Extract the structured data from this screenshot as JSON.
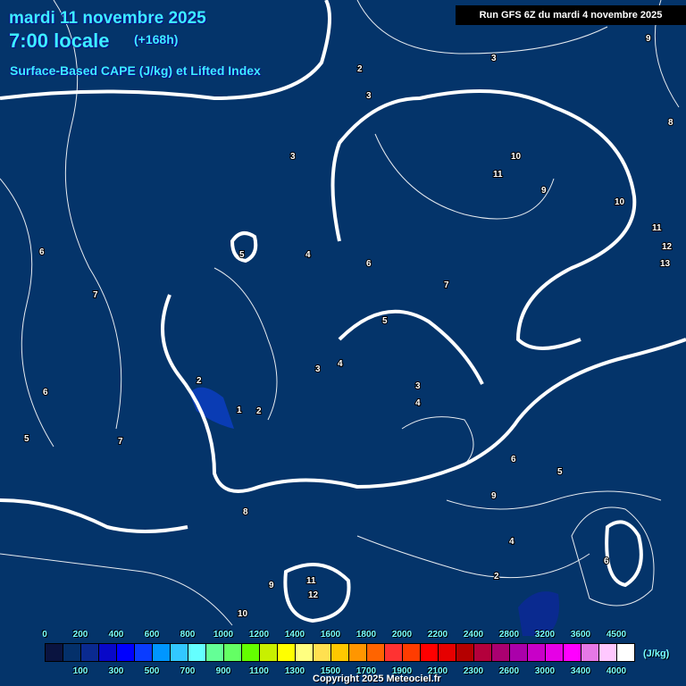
{
  "header": {
    "date": "mardi 11 novembre 2025",
    "time": "7:00 locale",
    "lead": "(+168h)",
    "parameter": "Surface-Based CAPE (J/kg) et Lifted Index",
    "run": "Run GFS 6Z du mardi 4 novembre 2025"
  },
  "legend": {
    "unit": "(J/kg)",
    "colors": [
      "#0a1440",
      "#04306a",
      "#0a2a90",
      "#0808c8",
      "#0000ff",
      "#0a3cff",
      "#0096ff",
      "#32c8ff",
      "#64ffff",
      "#64ff96",
      "#64ff64",
      "#64ff00",
      "#c8f000",
      "#ffff00",
      "#ffff80",
      "#ffe050",
      "#ffc800",
      "#ff9600",
      "#ff6400",
      "#ff3232",
      "#ff3c00",
      "#ff0000",
      "#e60000",
      "#b40000",
      "#b4003c",
      "#aa0070",
      "#aa00aa",
      "#c800c8",
      "#e600e6",
      "#ff00ff",
      "#e678e6",
      "#ffc8ff",
      "#ffffff"
    ],
    "top_labels": [
      "0",
      "200",
      "400",
      "600",
      "800",
      "1000",
      "1200",
      "1400",
      "1600",
      "1800",
      "2000",
      "2200",
      "2400",
      "2800",
      "3200",
      "3600",
      "4500"
    ],
    "bottom_labels": [
      "100",
      "300",
      "500",
      "700",
      "900",
      "1100",
      "1300",
      "1500",
      "1700",
      "1900",
      "2100",
      "2300",
      "2600",
      "3000",
      "3400",
      "4000"
    ]
  },
  "lifted_index_labels": [
    {
      "v": "2"
    },
    {
      "v": "3"
    },
    {
      "v": "3"
    },
    {
      "v": "4"
    },
    {
      "v": "5"
    },
    {
      "v": "6"
    },
    {
      "v": "7"
    },
    {
      "v": "6"
    },
    {
      "v": "7"
    },
    {
      "v": "5"
    },
    {
      "v": "6"
    },
    {
      "v": "10"
    },
    {
      "v": "11"
    },
    {
      "v": "9"
    },
    {
      "v": "10"
    },
    {
      "v": "11"
    },
    {
      "v": "12"
    },
    {
      "v": "13"
    },
    {
      "v": "8"
    },
    {
      "v": "9"
    },
    {
      "v": "3"
    },
    {
      "v": "4"
    },
    {
      "v": "3"
    },
    {
      "v": "2"
    },
    {
      "v": "1"
    },
    {
      "v": "2"
    },
    {
      "v": "3"
    },
    {
      "v": "4"
    },
    {
      "v": "5"
    },
    {
      "v": "8"
    },
    {
      "v": "9"
    },
    {
      "v": "11"
    },
    {
      "v": "12"
    },
    {
      "v": "10"
    },
    {
      "v": "9"
    },
    {
      "v": "6"
    },
    {
      "v": "4"
    },
    {
      "v": "2"
    },
    {
      "v": "5"
    },
    {
      "v": "7"
    },
    {
      "v": "6"
    }
  ],
  "copyright": "Copyright 2025 Meteociel.fr"
}
